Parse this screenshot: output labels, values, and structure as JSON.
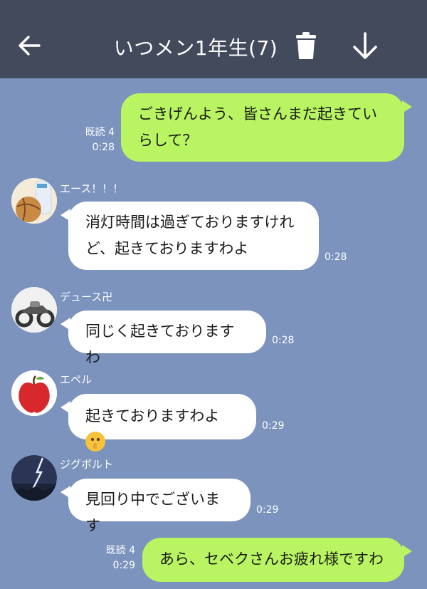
{
  "header": {
    "title": "いつメン1年生(7)",
    "icons": [
      "back-arrow-icon",
      "trash-icon",
      "download-arrow-icon"
    ],
    "background": "#434a5c"
  },
  "colors": {
    "chat_background": "#7b93bd",
    "outgoing_bubble": "#b9f562",
    "incoming_bubble": "#ffffff"
  },
  "messages": [
    {
      "direction": "out",
      "line1": "ごきげんよう、皆さんまだ起きてい",
      "line2": "らして？",
      "read": "既読 4",
      "time": "0:28"
    },
    {
      "direction": "in",
      "sender": "エース！！！",
      "line1": "消灯時間は過ぎておりますけれ",
      "line2": "ど、起きておりますわよ",
      "time": "0:28"
    },
    {
      "direction": "in",
      "sender": "デュース卍",
      "line1": "同じく起きておりますわ",
      "time": "0:28"
    },
    {
      "direction": "in",
      "sender": "エペル",
      "line1": "起きておりますわよ",
      "emoji": "shushing-face-emoji",
      "time": "0:29"
    },
    {
      "direction": "in",
      "sender": "ジグボルト",
      "line1": "見回り中でございます",
      "time": "0:29"
    },
    {
      "direction": "out",
      "line1": "あら、セベクさんお疲れ様ですわ",
      "read": "既読 4",
      "time": "0:29"
    }
  ]
}
